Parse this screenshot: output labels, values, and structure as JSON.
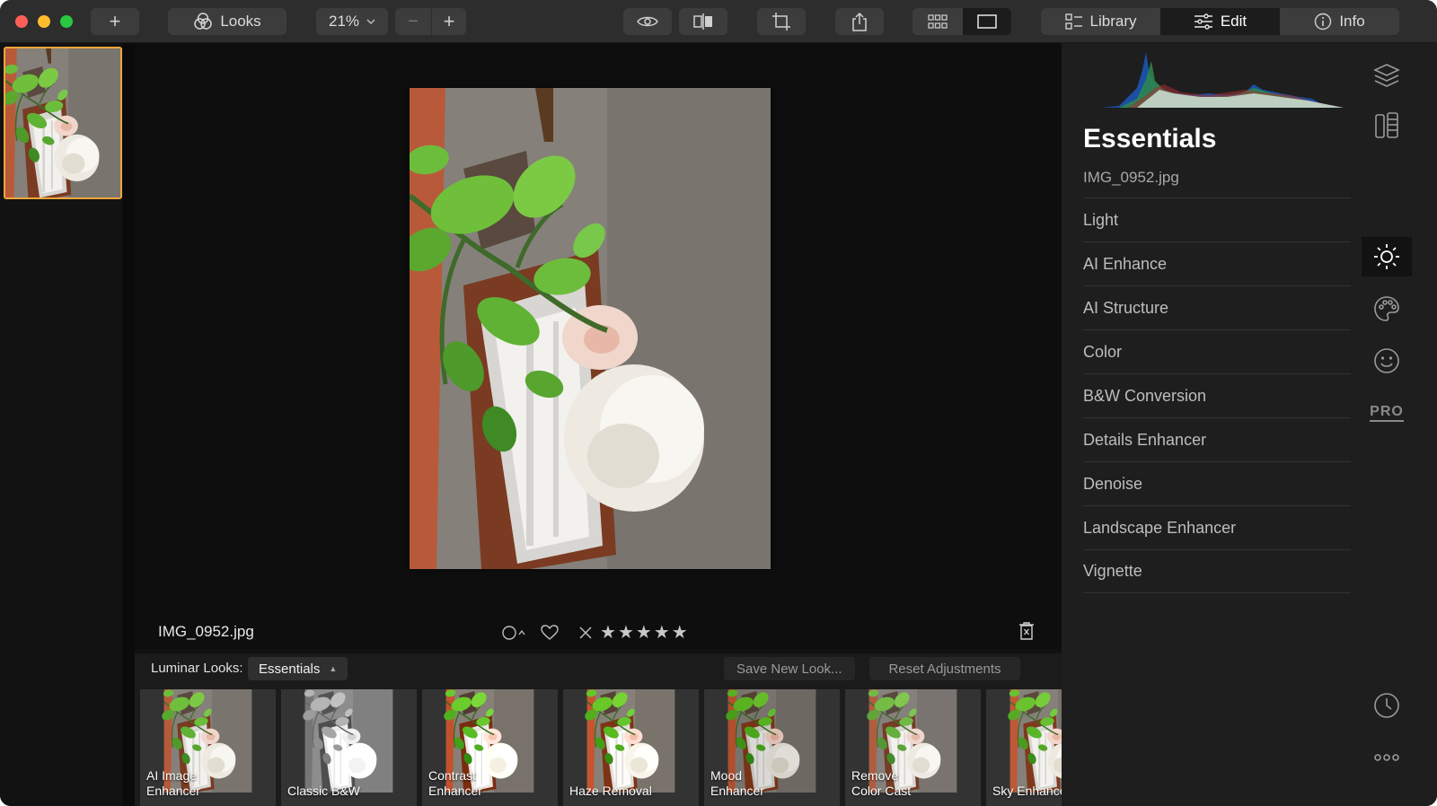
{
  "toolbar": {
    "add_label": "+",
    "looks_label": "Looks",
    "zoom_value": "21%",
    "zoom_out": "−",
    "zoom_in": "+",
    "tabs": [
      {
        "label": "Library",
        "icon": "library-icon"
      },
      {
        "label": "Edit",
        "icon": "sliders-icon",
        "active": true
      },
      {
        "label": "Info",
        "icon": "info-icon"
      }
    ]
  },
  "filmstrip": {
    "selected": "IMG_0952.jpg"
  },
  "canvas": {
    "filename": "IMG_0952.jpg",
    "stars": [
      "★",
      "★",
      "★",
      "★",
      "★"
    ]
  },
  "looks": {
    "label": "Luminar Looks:",
    "category": "Essentials",
    "save_label": "Save New Look...",
    "reset_label": "Reset Adjustments",
    "items": [
      {
        "line1": "AI Image",
        "line2": "Enhancer",
        "filter": "none"
      },
      {
        "line1": "Classic B&W",
        "line2": "",
        "filter": "grayscale(1) brightness(1.1)"
      },
      {
        "line1": "Contrast",
        "line2": "Enhancer",
        "filter": "contrast(1.2)"
      },
      {
        "line1": "Haze Removal",
        "line2": "",
        "filter": "contrast(1.1) saturate(1.1)"
      },
      {
        "line1": "Mood",
        "line2": "Enhancer",
        "filter": "brightness(0.9) saturate(1.2)"
      },
      {
        "line1": "Remove",
        "line2": "Color Cast",
        "filter": "saturate(0.9)"
      },
      {
        "line1": "Sky Enhancer",
        "line2": "",
        "filter": "saturate(1.1)"
      }
    ]
  },
  "panel": {
    "title": "Essentials",
    "filename": "IMG_0952.jpg",
    "tools": [
      "Light",
      "AI Enhance",
      "AI Structure",
      "Color",
      "B&W Conversion",
      "Details Enhancer",
      "Denoise",
      "Landscape Enhancer",
      "Vignette"
    ]
  },
  "side_icons": {
    "pro_label": "PRO",
    "items": [
      "layers-icon",
      "canvas-icon",
      "essentials-sun-icon",
      "creative-palette-icon",
      "portrait-face-icon",
      "pro-icon",
      "history-clock-icon",
      "more-icon"
    ]
  },
  "colors": {
    "accent": "#f0a63a",
    "panel_bg": "#1e1e1e",
    "canvas_bg": "#0e0e0e"
  }
}
